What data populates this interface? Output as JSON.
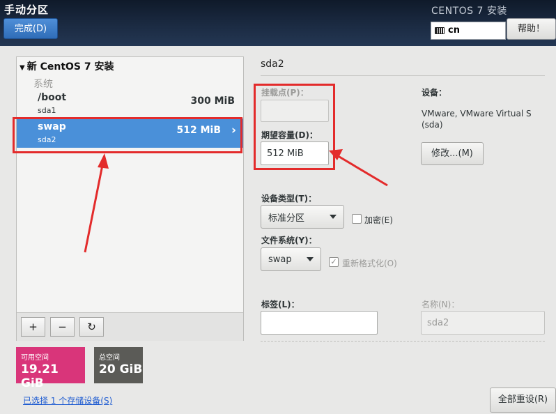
{
  "header": {
    "title": "手动分区",
    "install_label": "CENTOS 7 安装",
    "done_button": "完成(D)",
    "keyboard_layout": "cn",
    "help_button": "帮助！"
  },
  "tree": {
    "title": "新 CentOS 7 安装",
    "group_label": "系统",
    "partitions": [
      {
        "name": "/boot",
        "device": "sda1",
        "size": "300 MiB",
        "selected": false
      },
      {
        "name": "swap",
        "device": "sda2",
        "size": "512 MiB",
        "selected": true
      }
    ],
    "toolbar": {
      "add": "+",
      "remove": "−",
      "refresh": "↻"
    }
  },
  "space": {
    "available_label": "可用空间",
    "available_value": "19.21 GiB",
    "total_label": "总空间",
    "total_value": "20 GiB",
    "available_color": "#d9357a",
    "total_color": "#5b5b57"
  },
  "storage_link": "已选择 1 个存储设备(S)",
  "details": {
    "device_title": "sda2",
    "mount_label": "挂载点(P)：",
    "mount_value": "",
    "capacity_label": "期望容量(D)：",
    "capacity_value": "512 MiB",
    "device_label": "设备：",
    "device_desc": "VMware, VMware Virtual S (sda)",
    "modify_button": "修改...(M)",
    "device_type_label": "设备类型(T)：",
    "device_type_value": "标准分区",
    "encrypt_label": "加密(E)",
    "encrypt_checked": false,
    "fs_label": "文件系统(Y)：",
    "fs_value": "swap",
    "reformat_label": "重新格式化(O)",
    "reformat_checked": true,
    "tag_label": "标签(L)：",
    "tag_value": "",
    "name_label": "名称(N)：",
    "name_value": "sda2"
  },
  "reset_button": "全部重设(R)",
  "accent_color": "#4a90d9",
  "annotation_color": "#e32b2b"
}
